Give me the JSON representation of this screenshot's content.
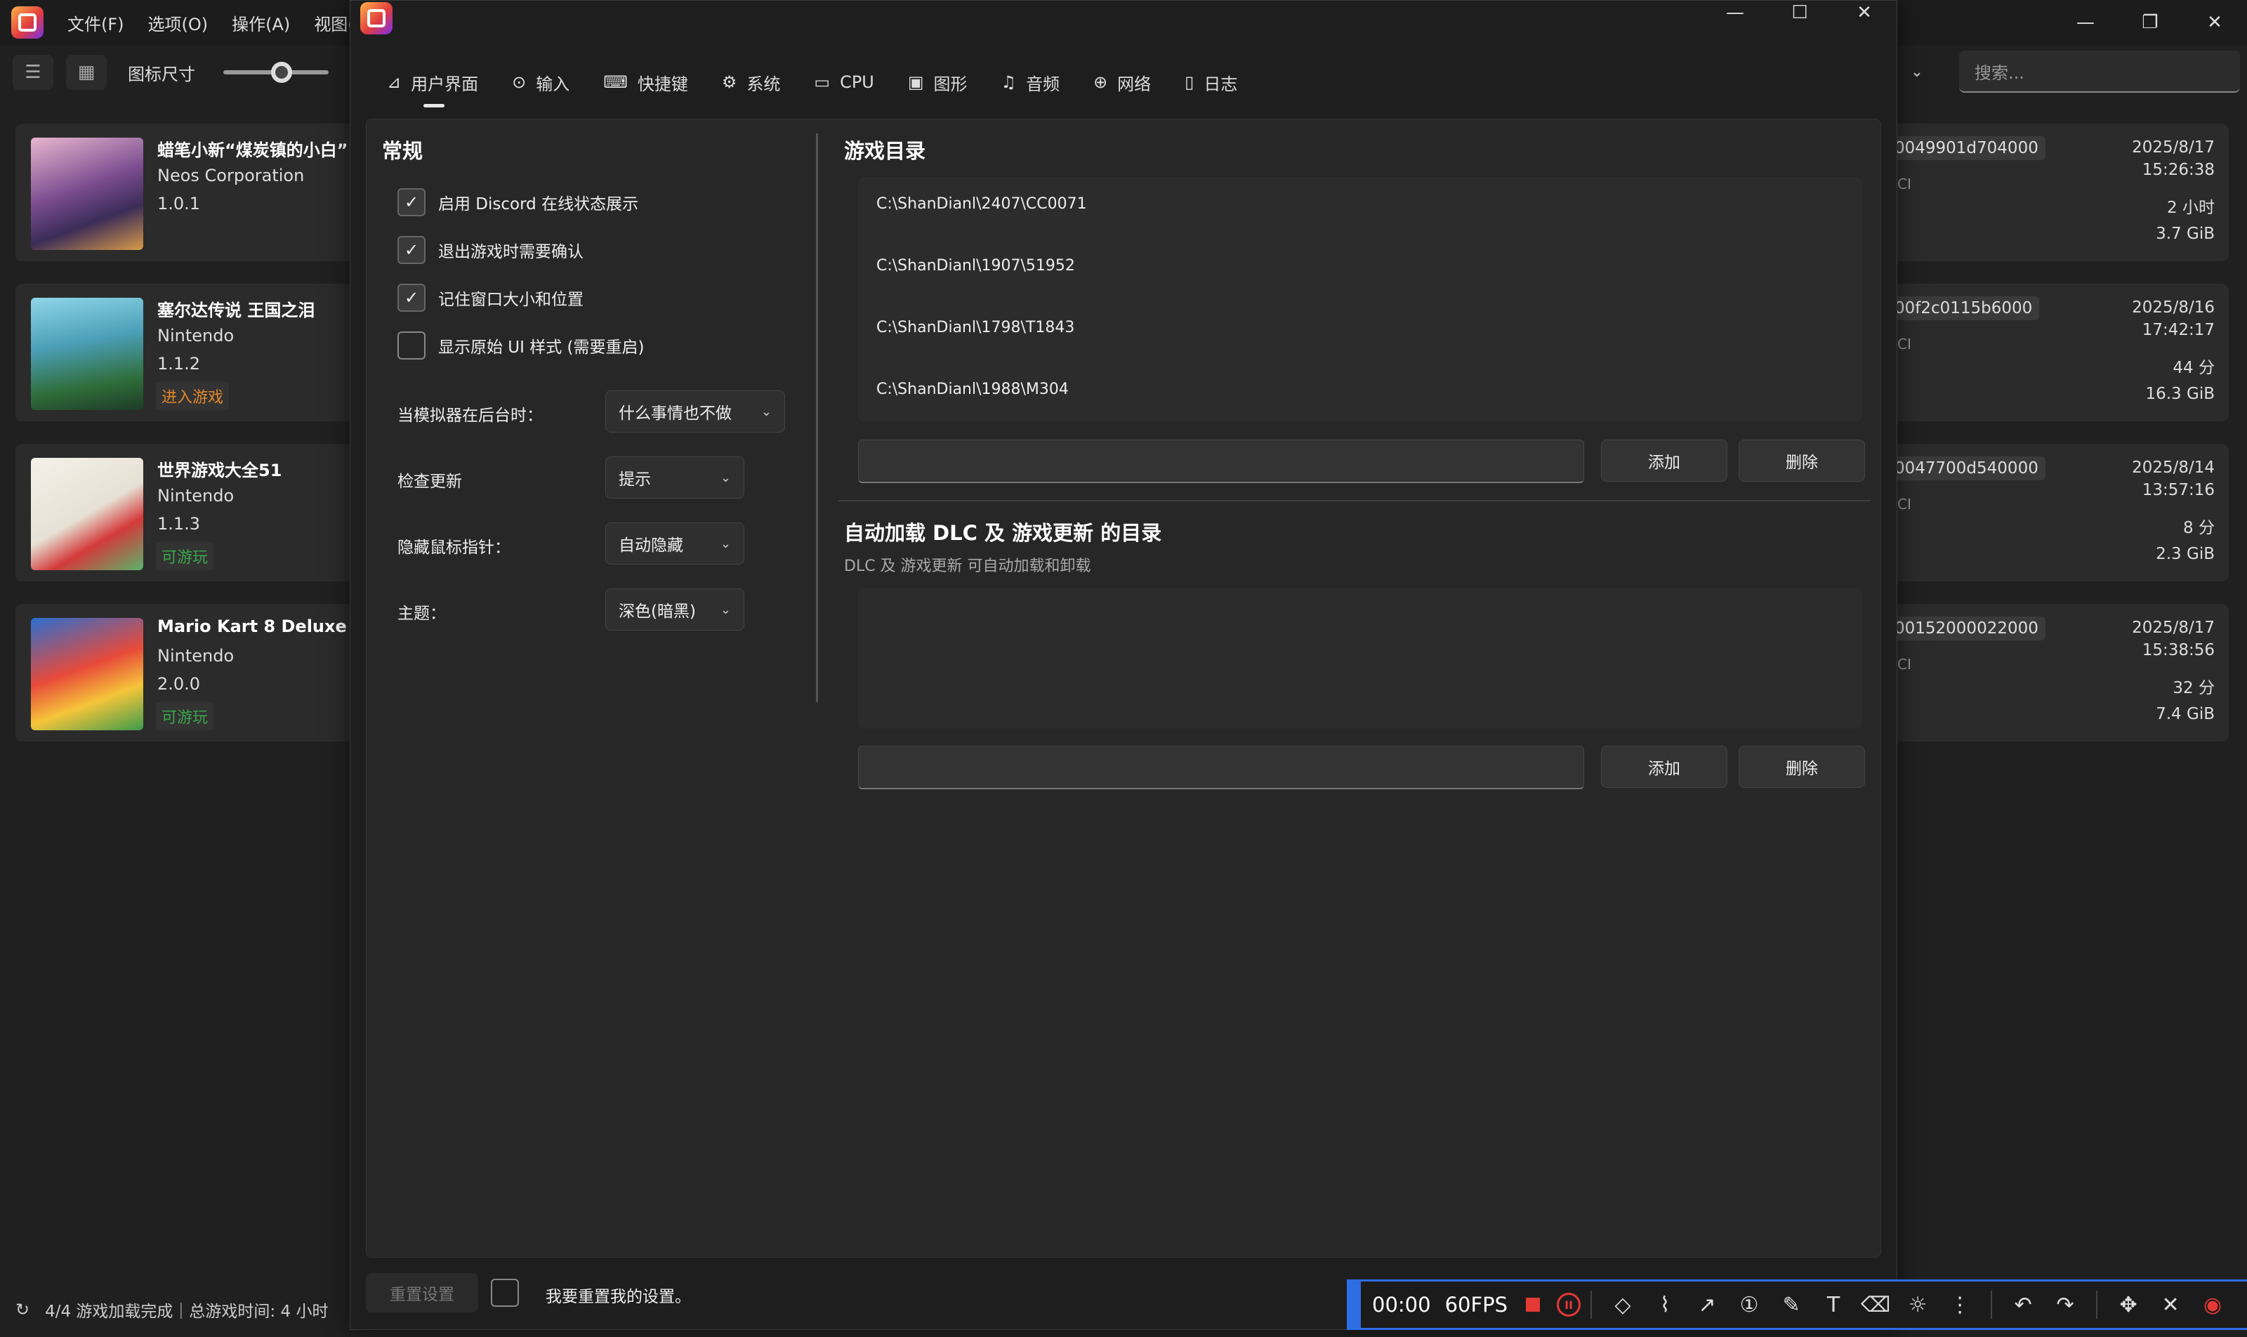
{
  "main": {
    "menu": [
      "文件(F)",
      "选项(O)",
      "操作(A)",
      "视图("
    ],
    "toolbar": {
      "icon_size_label": "图标尺寸",
      "icon_size_value": 0.55
    },
    "search": {
      "placeholder": "搜索..."
    },
    "games": [
      {
        "title": "蜡笔小新“煤炭镇的小白”",
        "publisher": "Neos Corporation",
        "version": "1.0.1",
        "badge": "",
        "id": "0049901d704000",
        "index": "CI",
        "date": "2025/8/17",
        "time": "15:26:38",
        "playtime": "2 小时",
        "size": "3.7 GiB"
      },
      {
        "title": "塞尔达传说 王国之泪",
        "publisher": "Nintendo",
        "version": "1.1.2",
        "badge": "进入游戏",
        "badge_color": "#e0872a",
        "id": "00f2c0115b6000",
        "index": "CI",
        "date": "2025/8/16",
        "time": "17:42:17",
        "playtime": "44 分",
        "size": "16.3 GiB"
      },
      {
        "title": "世界游戏大全51",
        "publisher": "Nintendo",
        "version": "1.1.3",
        "badge": "可游玩",
        "badge_color": "#3aa64a",
        "id": "0047700d540000",
        "index": "CI",
        "date": "2025/8/14",
        "time": "13:57:16",
        "playtime": "8 分",
        "size": "2.3 GiB"
      },
      {
        "title": "Mario Kart 8 Deluxe",
        "publisher": "Nintendo",
        "version": "2.0.0",
        "badge": "可游玩",
        "badge_color": "#3aa64a",
        "id": "00152000022000",
        "index": "CI",
        "date": "2025/8/17",
        "time": "15:38:56",
        "playtime": "32 分",
        "size": "7.4 GiB"
      }
    ],
    "status_bar": "4/4 游戏加载完成｜总游戏时间: 4 小时"
  },
  "dialog": {
    "tabs": [
      {
        "label": "用户界面",
        "icon": "ui-icon"
      },
      {
        "label": "输入",
        "icon": "gamepad-icon"
      },
      {
        "label": "快捷键",
        "icon": "keyboard-icon"
      },
      {
        "label": "系统",
        "icon": "gear-icon"
      },
      {
        "label": "CPU",
        "icon": "cpu-icon"
      },
      {
        "label": "图形",
        "icon": "image-icon"
      },
      {
        "label": "音频",
        "icon": "music-icon"
      },
      {
        "label": "网络",
        "icon": "globe-icon"
      },
      {
        "label": "日志",
        "icon": "document-icon"
      }
    ],
    "general": {
      "title": "常规",
      "checkboxes": [
        {
          "label": "启用 Discord 在线状态展示",
          "checked": true
        },
        {
          "label": "退出游戏时需要确认",
          "checked": true
        },
        {
          "label": "记住窗口大小和位置",
          "checked": true
        },
        {
          "label": "显示原始 UI 样式 (需要重启)",
          "checked": false
        }
      ],
      "options": [
        {
          "label": "当模拟器在后台时：",
          "value": "什么事情也不做"
        },
        {
          "label": "检查更新",
          "value": "提示"
        },
        {
          "label": "隐藏鼠标指针：",
          "value": "自动隐藏"
        },
        {
          "label": "主题：",
          "value": "深色(暗黑)"
        }
      ]
    },
    "game_dirs": {
      "title": "游戏目录",
      "items": [
        "C:\\ShanDianl\\2407\\CC0071",
        "C:\\ShanDianl\\1907\\51952",
        "C:\\ShanDianl\\1798\\T1843",
        "C:\\ShanDianl\\1988\\M304"
      ],
      "add": "添加",
      "remove": "删除"
    },
    "dlc_dirs": {
      "title": "自动加载 DLC 及 游戏更新 的目录",
      "subtitle": "DLC 及 游戏更新 可自动加载和卸载",
      "add": "添加",
      "remove": "删除"
    },
    "footer": {
      "reset_button": "重置设置",
      "reset_confirm": "我要重置我的设置。"
    }
  },
  "recorder": {
    "time": "00:00",
    "fps": "60FPS",
    "accent_color": "#2e6de3",
    "record_color": "#e53935"
  }
}
